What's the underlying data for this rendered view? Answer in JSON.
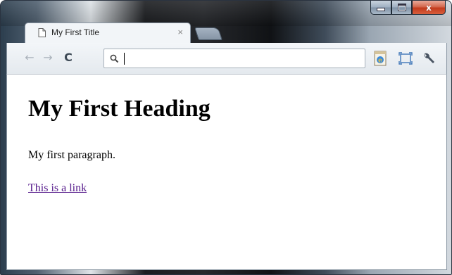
{
  "browser": {
    "tab": {
      "title": "My First Title",
      "close_glyph": "×"
    },
    "nav": {
      "back_icon": "back-arrow-icon",
      "forward_icon": "forward-arrow-icon",
      "reload_icon": "reload-icon"
    },
    "omnibox": {
      "value": "",
      "placeholder": ""
    },
    "window_controls": {
      "close_glyph": "x"
    }
  },
  "page": {
    "heading": "My First Heading",
    "paragraph": "My first paragraph.",
    "link_text": "This is a link"
  },
  "colors": {
    "link_visited": "#551a8b",
    "close_button": "#c9452a"
  }
}
